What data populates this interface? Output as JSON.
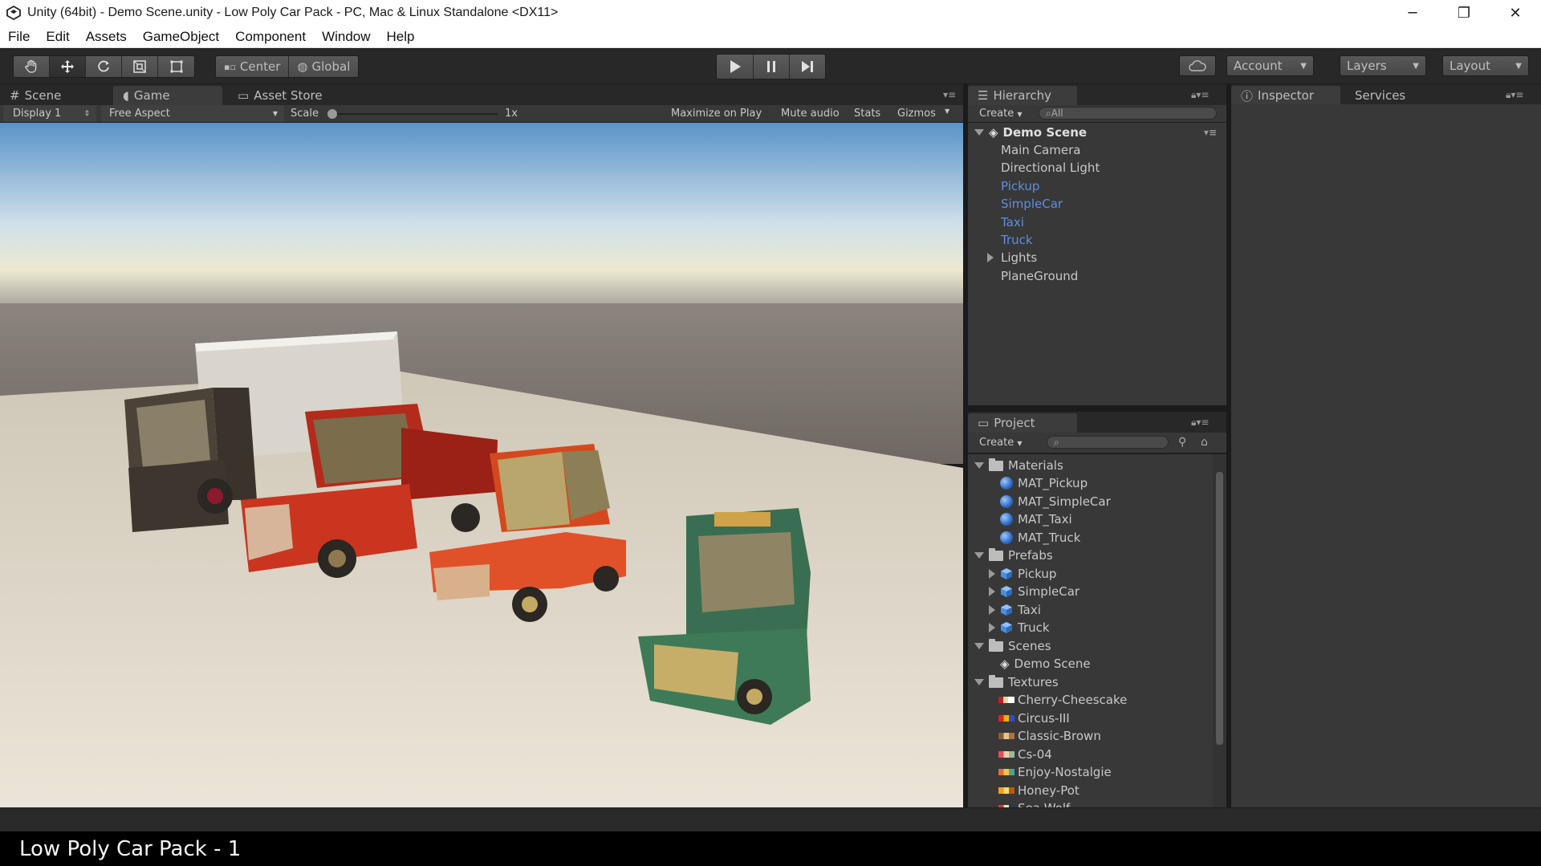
{
  "window": {
    "title": "Unity (64bit) - Demo Scene.unity - Low Poly Car Pack - PC, Mac & Linux Standalone <DX11>",
    "controls": [
      "─",
      "❐",
      "✕"
    ]
  },
  "menu": [
    "File",
    "Edit",
    "Assets",
    "GameObject",
    "Component",
    "Window",
    "Help"
  ],
  "toolbar": {
    "pivot_center": "Center",
    "pivot_global": "Global",
    "account": "Account",
    "layers": "Layers",
    "layout": "Layout"
  },
  "scene_panel": {
    "tabs": [
      "Scene",
      "Game",
      "Asset Store"
    ],
    "active_tab": "Game",
    "display": "Display 1",
    "aspect": "Free Aspect",
    "scale_label": "Scale",
    "scale_value": "1x",
    "maximize_on_play": "Maximize on Play",
    "mute_audio": "Mute audio",
    "stats": "Stats",
    "gizmos": "Gizmos"
  },
  "hierarchy": {
    "tab": "Hierarchy",
    "create": "Create",
    "search_placeholder": "All",
    "scene": "Demo Scene",
    "items": [
      {
        "label": "Main Camera",
        "prefab": false,
        "expandable": false
      },
      {
        "label": "Directional Light",
        "prefab": false,
        "expandable": false
      },
      {
        "label": "Pickup",
        "prefab": true,
        "expandable": false
      },
      {
        "label": "SimpleCar",
        "prefab": true,
        "expandable": false
      },
      {
        "label": "Taxi",
        "prefab": true,
        "expandable": false
      },
      {
        "label": "Truck",
        "prefab": true,
        "expandable": false
      },
      {
        "label": "Lights",
        "prefab": false,
        "expandable": true
      },
      {
        "label": "PlaneGround",
        "prefab": false,
        "expandable": false
      }
    ]
  },
  "project": {
    "tab": "Project",
    "create": "Create",
    "folders": {
      "materials": "Materials",
      "prefabs": "Prefabs",
      "scenes": "Scenes",
      "textures": "Textures"
    },
    "materials": [
      "MAT_Pickup",
      "MAT_SimpleCar",
      "MAT_Taxi",
      "MAT_Truck"
    ],
    "prefabs": [
      "Pickup",
      "SimpleCar",
      "Taxi",
      "Truck"
    ],
    "scenes": [
      "Demo Scene"
    ],
    "textures": [
      "Cherry-Cheescake",
      "Circus-III",
      "Classic-Brown",
      "Cs-04",
      "Enjoy-Nostalgie",
      "Honey-Pot",
      "Sea-Wolf"
    ]
  },
  "inspector": {
    "tabs": [
      "Inspector",
      "Services"
    ]
  },
  "caption": "Low Poly Car Pack - 1"
}
